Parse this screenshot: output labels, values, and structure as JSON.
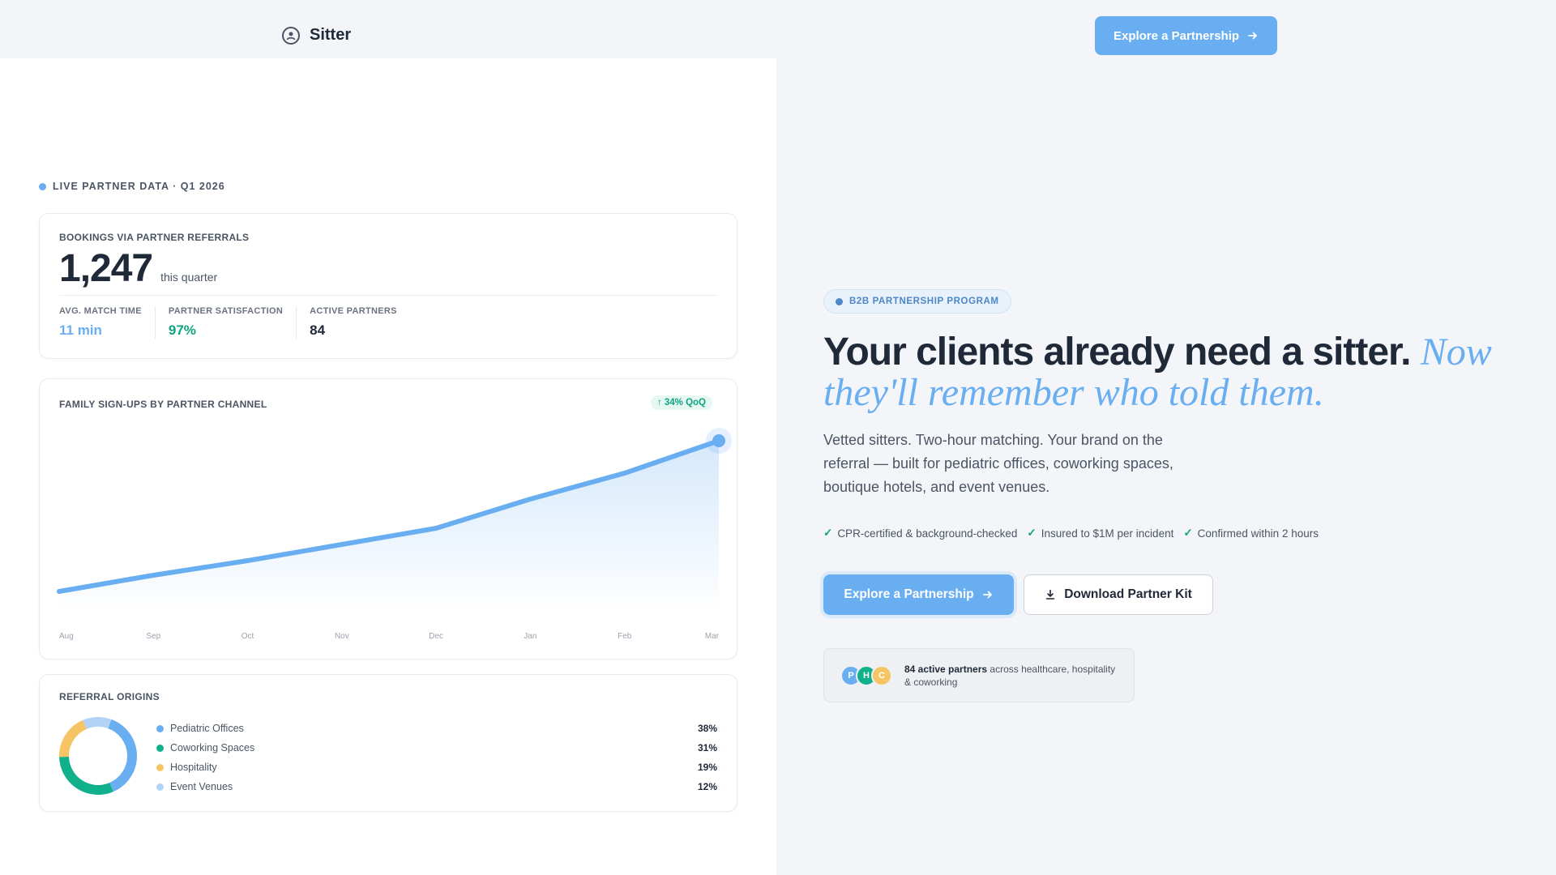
{
  "header": {
    "brand_name": "Sitter",
    "cta_label": "Explore a Partnership"
  },
  "live_label": "LIVE PARTNER DATA · Q1 2026",
  "bookings_card": {
    "label": "BOOKINGS VIA PARTNER REFERRALS",
    "value": "1,247",
    "sub": "this quarter",
    "stats": [
      {
        "label": "AVG. MATCH TIME",
        "value": "11 min",
        "color": "#6aaef2"
      },
      {
        "label": "PARTNER SATISFACTION",
        "value": "97%",
        "color": "#10a37f"
      },
      {
        "label": "ACTIVE PARTNERS",
        "value": "84",
        "color": "#1f2937"
      }
    ]
  },
  "signups_card": {
    "label": "FAMILY SIGN-UPS BY PARTNER CHANNEL",
    "badge": "↑ 34% QoQ"
  },
  "chart_data": {
    "type": "area",
    "title": "FAMILY SIGN-UPS BY PARTNER CHANNEL",
    "categories": [
      "Aug",
      "Sep",
      "Oct",
      "Nov",
      "Dec",
      "Jan",
      "Feb",
      "Mar"
    ],
    "series": [
      {
        "values": [
          0.0,
          0.1,
          0.19,
          0.29,
          0.39,
          0.57,
          0.73,
          0.93
        ]
      }
    ],
    "ylim": [
      0,
      1
    ],
    "grid": false,
    "color": "#6aaef2"
  },
  "origins_card": {
    "label": "REFERRAL ORIGINS",
    "items": [
      {
        "name": "Pediatric Offices",
        "pct": "38%",
        "value": 38,
        "color": "#6aaef2"
      },
      {
        "name": "Coworking Spaces",
        "pct": "31%",
        "value": 31,
        "color": "#10b08a"
      },
      {
        "name": "Hospitality",
        "pct": "19%",
        "value": 19,
        "color": "#f5c565"
      },
      {
        "name": "Event Venues",
        "pct": "12%",
        "value": 12,
        "color": "#b2d3f5"
      }
    ]
  },
  "hero": {
    "badge": "B2B PARTNERSHIP PROGRAM",
    "headline_main": "Your clients already need a sitter.",
    "headline_accent": "Now they'll remember who told them.",
    "lede": "Vetted sitters. Two-hour matching. Your brand on the referral — built for pediatric offices, coworking spaces, boutique hotels, and event venues.",
    "checks": [
      "CPR-certified & background-checked",
      "Insured to $1M per incident",
      "Confirmed within 2 hours"
    ],
    "primary_cta": "Explore a Partnership",
    "secondary_cta": "Download Partner Kit",
    "partners_bold": "84 active partners",
    "partners_rest": "across healthcare, hospitality & coworking",
    "avatars": [
      {
        "letter": "P",
        "color": "#6aaef2"
      },
      {
        "letter": "H",
        "color": "#10b08a"
      },
      {
        "letter": "C",
        "color": "#f5c565"
      }
    ]
  },
  "colors": {
    "accent": "#6aaef2",
    "success": "#10a37f",
    "text": "#1f2937"
  }
}
